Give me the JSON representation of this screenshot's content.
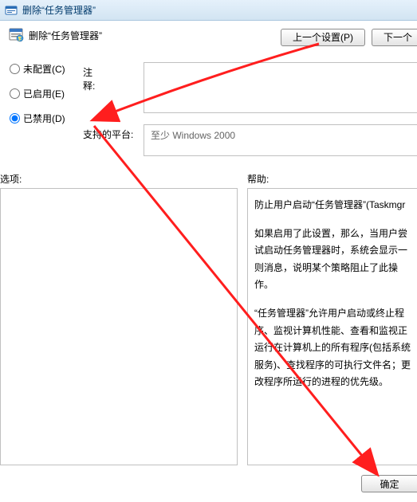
{
  "window": {
    "title": "删除“任务管理器”"
  },
  "header": {
    "subtitle": "删除“任务管理器”"
  },
  "buttons": {
    "prev": "上一个设置(P)",
    "next": "下一个",
    "ok": "确定"
  },
  "radios": {
    "not_configured": "未配置(C)",
    "enabled": "已启用(E)",
    "disabled": "已禁用(D)",
    "selected": "disabled"
  },
  "labels": {
    "comment": "注释:",
    "platform": "支持的平台:",
    "options": "选项:",
    "help": "帮助:"
  },
  "fields": {
    "comment_value": "",
    "platform_value": "至少 Windows 2000"
  },
  "help": {
    "p1": "防止用户启动“任务管理器”(Taskmgr",
    "p2": "如果启用了此设置，那么，当用户尝试启动任务管理器时，系统会显示一则消息，说明某个策略阻止了此操作。",
    "p3": "“任务管理器”允许用户启动或终止程序、监视计算机性能、查看和监视正运行在计算机上的所有程序(包括系统服务)、查找程序的可执行文件名；更改程序所运行的进程的优先级。"
  }
}
